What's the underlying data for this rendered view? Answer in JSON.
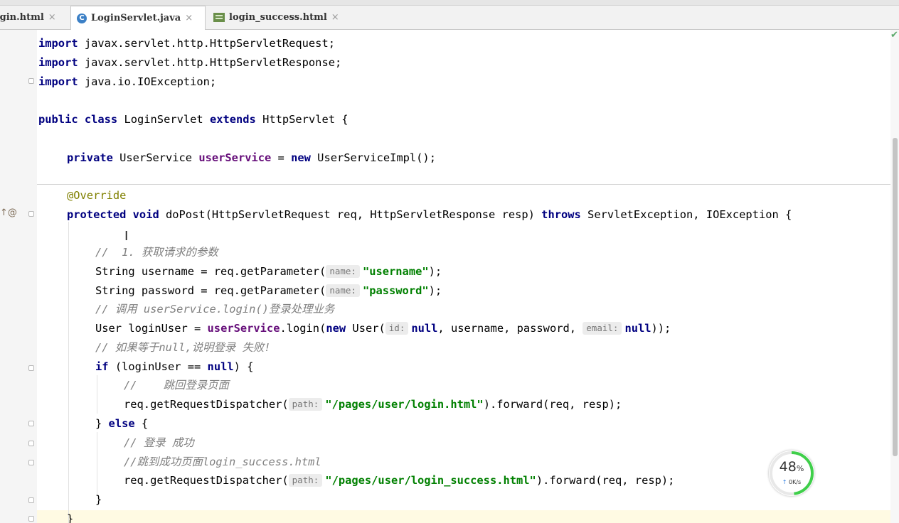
{
  "tabs": [
    {
      "label": "login.html",
      "icon": "html-file-icon",
      "active": false
    },
    {
      "label": "LoginServlet.java",
      "icon": "java-class-icon",
      "active": true
    },
    {
      "label": "login_success.html",
      "icon": "html-file-icon",
      "active": false
    }
  ],
  "tab_close_glyph": "×",
  "code": {
    "import1": [
      "import",
      " javax.servlet.http.HttpServletRequest;"
    ],
    "import2": [
      "import",
      " javax.servlet.http.HttpServletResponse;"
    ],
    "import3": [
      "import",
      " java.io.IOException;"
    ],
    "class_decl": [
      "public class",
      " LoginServlet ",
      "extends",
      " HttpServlet {"
    ],
    "field_decl": [
      "private",
      " UserService ",
      "userService",
      " = ",
      "new",
      " UserServiceImpl();"
    ],
    "override": "@Override",
    "method_decl": [
      "protected void",
      " doPost(HttpServletRequest req, HttpServletResponse resp) ",
      "throws",
      " ServletException, IOException {"
    ],
    "comment1": "//  1. 获取请求的参数",
    "username_line": [
      "String username = req.getParameter(",
      "name:",
      "\"username\"",
      ");"
    ],
    "password_line": [
      "String password = req.getParameter(",
      "name:",
      "\"password\"",
      ");"
    ],
    "comment2": "// 调用 userService.login()登录处理业务",
    "login_line": [
      "User loginUser = ",
      "userService",
      ".login(",
      "new",
      " User(",
      "id:",
      "null",
      ", username, password, ",
      "email:",
      "null",
      "));"
    ],
    "comment3": "// 如果等于null,说明登录 失败!",
    "if_line": [
      "if",
      " (loginUser == ",
      "null",
      ") {"
    ],
    "comment4": "//    跳回登录页面",
    "dispatch1": [
      "req.getRequestDispatcher(",
      "path:",
      "\"/pages/user/login.html\"",
      ").forward(req, resp);"
    ],
    "else_line": [
      "} ",
      "else",
      " {"
    ],
    "comment5": "// 登录 成功",
    "comment6": "//跳到成功页面login_success.html",
    "dispatch2": [
      "req.getRequestDispatcher(",
      "path:",
      "\"/pages/user/login_success.html\"",
      ").forward(req, resp);"
    ],
    "close_inner": "}",
    "close_method": "}"
  },
  "gutter_marker": "↑@",
  "inspection_ok": "✔",
  "cursor_glyph": "I",
  "network_widget": {
    "percent": "48",
    "percent_unit": "%",
    "percent_value": 48,
    "speed": "0K/s",
    "arrow": "↑",
    "ring_color": "#3fcf4a"
  },
  "colors": {
    "keyword": "#000080",
    "field": "#660e7a",
    "string": "#008000",
    "comment": "#808080",
    "annotation": "#808000"
  }
}
